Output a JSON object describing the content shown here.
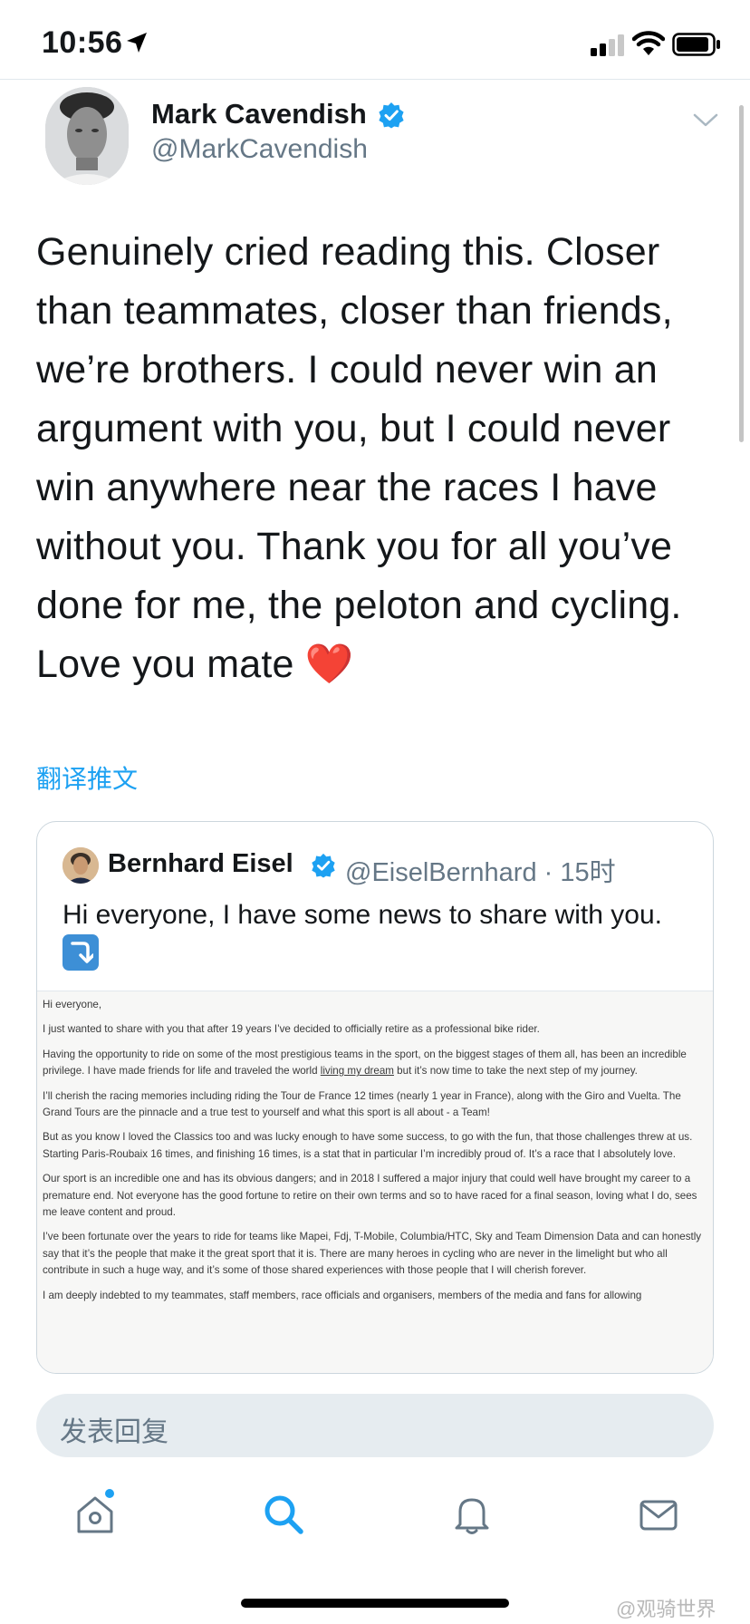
{
  "status_bar": {
    "time": "10:56"
  },
  "tweet": {
    "author_name": "Mark Cavendish",
    "author_handle": "@MarkCavendish",
    "text": "Genuinely cried reading this. Closer than teammates, closer than friends, we’re brothers. I could never win an argument with you, but I could never win anywhere near the races I have without you. Thank you for all you’ve done for me, the peloton and cycling. Love you mate",
    "emoji": "❤️",
    "translate_label": "翻译推文"
  },
  "quoted_tweet": {
    "author_name": "Bernhard Eisel",
    "author_handle": "@EiselBernhard · 15时",
    "text": "Hi everyone, I have some news to share with you.",
    "letter": {
      "p1": "Hi everyone,",
      "p2": "I just wanted to share with you that after 19 years I’ve decided to officially retire as a professional bike rider.",
      "p3a": "Having the opportunity to ride on some of the most prestigious teams in the sport, on the biggest stages of them all, has been an incredible privilege. I have made friends for life and traveled the world ",
      "p3u": "living my dream",
      "p3b": " but it’s now time to take the next step of my journey.",
      "p4": "I’ll cherish the racing memories including riding the Tour de France 12 times (nearly 1 year in France), along with the Giro and Vuelta. The Grand Tours are the pinnacle and a true test to yourself and what this sport is all about - a Team!",
      "p5": "But as you know I loved the Classics too and was lucky enough to have some success, to go with the fun, that those challenges threw at us. Starting Paris-Roubaix 16 times, and finishing 16 times, is a stat that in particular I’m incredibly proud of. It’s a race that I absolutely love.",
      "p6": "Our sport is an incredible one and has its obvious dangers; and in 2018 I suffered a major injury that could well have brought my career to a premature end. Not everyone has the good fortune to retire on their own terms and so to have raced for a final season, loving what I do, sees me leave content and proud.",
      "p7": "I’ve been fortunate over the years to ride for teams like Mapei, Fdj, T-Mobile, Columbia/HTC, Sky and Team Dimension Data and can honestly say that it’s the people that make it the great sport that it is. There are many heroes in cycling who are never in the limelight but who all contribute in such a huge way, and it’s some of those shared experiences with those people that I will cherish forever.",
      "p8": "I am deeply indebted to my teammates, staff members, race officials and organisers, members of the media and fans for allowing"
    }
  },
  "reply": {
    "placeholder": "发表回复"
  },
  "tab_bar": {
    "items": [
      "home-icon",
      "search-icon",
      "bell-icon",
      "mail-icon"
    ],
    "active": "search-icon"
  },
  "watermark": "@观骑世界",
  "colors": {
    "accent": "#1da1f2",
    "text": "#14171a",
    "secondary": "#657786",
    "reply_bg": "#e6ecf0"
  }
}
